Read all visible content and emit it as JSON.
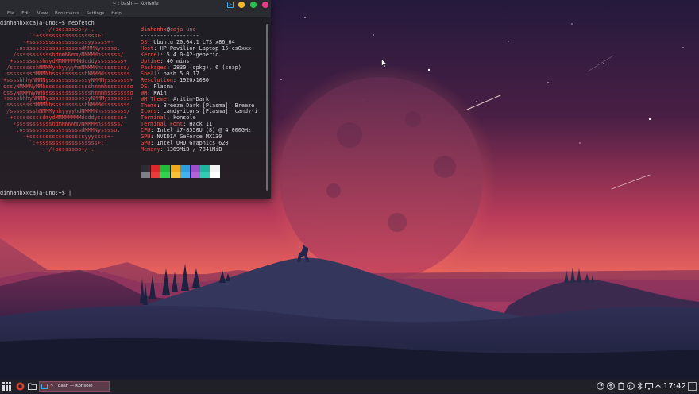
{
  "window": {
    "title": "~ : bash — Konsole",
    "menu": [
      "File",
      "Edit",
      "View",
      "Bookmarks",
      "Settings",
      "Help"
    ],
    "button_colors": [
      "#f6b627",
      "#27c24c",
      "#e93d8c"
    ]
  },
  "terminal": {
    "prompt_user": "dinhanhx@caja-uno",
    "prompt_suffix": ":~$",
    "command": "neofetch",
    "final_prompt_user": "dinhanhx@caja-uno",
    "final_prompt_suffix": ":~$ |",
    "ascii_art": [
      "             .-/+oossssoo+/-.",
      "         `:+ssssssssssssssssss+:`",
      "       -+ssssssssssssssssssyyssss+-",
      "     .ossssssssssssssssssdMMMNysssso.",
      "    /ssssssssssshdmmNNmmyNMMMMhssssss/",
      "   +ssssssssshmydMMMMMMMNddddyssssssss+",
      "  /sssssssshNMMMyhhyyyyhmNMMMNhssssssss/",
      " .ssssssssdMMMNhsssssssssshNMMMdssssssss.",
      " +sssshhhyNMMNyssssssssssssyNMMMysssssss+",
      " ossyNMMMNyMMhsssssssssssssshmmmhssssssso",
      " ossyNMMMNyMMhsssssssssssssshmmmhssssssso",
      " +sssshhhyNMMNyssssssssssssyNMMMysssssss+",
      " .ssssssssdMMMNhsssssssssshNMMMdssssssss.",
      "  /sssssssshNMMMyhhyyyyhdNMMMNhssssssss/",
      "   +sssssssssdmydMMMMMMMMddddyssssssss+",
      "    /ssssssssssshdmNNNNmyNMMMMhssssss/",
      "     .ossssssssssssssssssdMMMNysssso.",
      "       -+sssssssssssssssssyyyssss+-",
      "         `:+ssssssssssssssssss+:`",
      "             .-/+oossssoo+/-."
    ],
    "info_header_user": "dinhanhx",
    "info_header_at": "@",
    "info_header_host": "caja-uno",
    "info_separator": "------------------",
    "info": [
      {
        "key": "OS",
        "value": "Ubuntu 20.04.1 LTS x86_64"
      },
      {
        "key": "Host",
        "value": "HP Pavilion Laptop 15-cs0xxx"
      },
      {
        "key": "Kernel",
        "value": "5.4.0-42-generic"
      },
      {
        "key": "Uptime",
        "value": "40 mins"
      },
      {
        "key": "Packages",
        "value": "2830 (dpkg), 6 (snap)"
      },
      {
        "key": "Shell",
        "value": "bash 5.0.17"
      },
      {
        "key": "Resolution",
        "value": "1920x1080"
      },
      {
        "key": "DE",
        "value": "Plasma"
      },
      {
        "key": "WM",
        "value": "KWin"
      },
      {
        "key": "WM Theme",
        "value": "Aritim-Dark"
      },
      {
        "key": "Theme",
        "value": "Breeze Dark [Plasma], Breeze"
      },
      {
        "key": "Icons",
        "value": "candy-icons [Plasma], candy-i"
      },
      {
        "key": "Terminal",
        "value": "konsole"
      },
      {
        "key": "Terminal Font",
        "value": "Hack 11"
      },
      {
        "key": "CPU",
        "value": "Intel i7-8550U (8) @ 4.000GHz"
      },
      {
        "key": "GPU",
        "value": "NVIDIA GeForce MX130"
      },
      {
        "key": "GPU",
        "value": "Intel UHD Graphics 620"
      },
      {
        "key": "Memory",
        "value": "1369MiB / 7841MiB"
      }
    ],
    "palette_top": [
      "#2b2d33",
      "#e0262a",
      "#1fbe3a",
      "#f2a81b",
      "#2d9fe0",
      "#9e4fc7",
      "#1bb79c",
      "#f3f3f3"
    ],
    "palette_bottom": [
      "#7d8087",
      "#ec3b3d",
      "#2fd64d",
      "#f9c13a",
      "#42b3f0",
      "#b064d8",
      "#2fcdb2",
      "#ffffff"
    ]
  },
  "taskbar": {
    "task_label": "~ : bash — Konsole",
    "clock": "17:42",
    "launcher_icons": [
      "app-launcher-icon",
      "browser-icon",
      "folder-icon"
    ],
    "tray_icons": [
      "steam-icon",
      "update-icon",
      "clipboard-icon",
      "vpn-icon",
      "bluetooth-icon",
      "volume-icon",
      "display-icon",
      "network-icon",
      "chevron-up-icon"
    ]
  }
}
